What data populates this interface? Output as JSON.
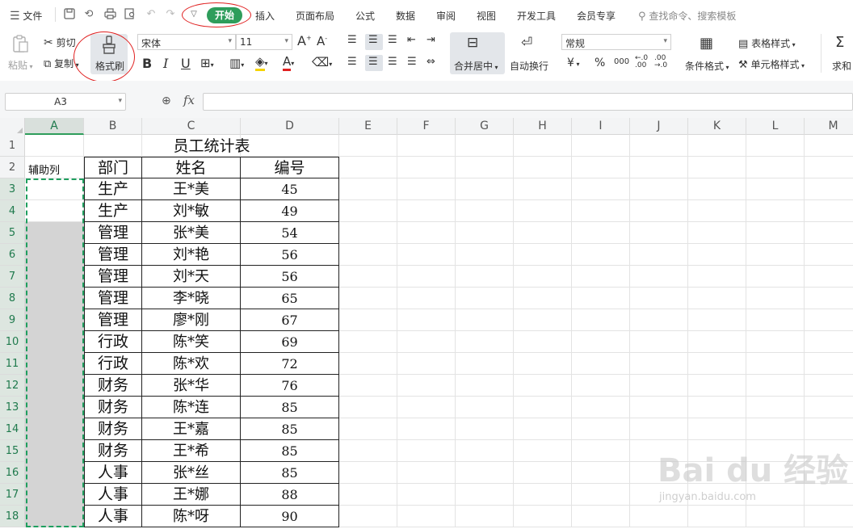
{
  "menubar": {
    "file_label": "文件",
    "tabs": [
      {
        "label": "开始",
        "active": true
      },
      {
        "label": "插入"
      },
      {
        "label": "页面布局"
      },
      {
        "label": "公式"
      },
      {
        "label": "数据"
      },
      {
        "label": "审阅"
      },
      {
        "label": "视图"
      },
      {
        "label": "开发工具"
      },
      {
        "label": "会员专享"
      }
    ],
    "search_placeholder": "查找命令、搜索模板"
  },
  "ribbon": {
    "paste": "粘贴",
    "cut": "剪切",
    "copy": "复制",
    "format_painter": "格式刷",
    "font_name": "宋体",
    "font_size": "11",
    "merge_center": "合并居中",
    "wrap_text": "自动换行",
    "number_format": "常规",
    "conditional_format": "条件格式",
    "table_style": "表格样式",
    "cell_style": "单元格样式",
    "sum": "求和",
    "currency_symbol": "¥",
    "percent_symbol": "%",
    "thousands_symbol": "000",
    "increase_decimal": "←.0\n.00",
    "decrease_decimal": ".00\n→.0"
  },
  "formula_bar": {
    "cell_ref": "A3",
    "fx": "fx",
    "formula": ""
  },
  "grid": {
    "columns": [
      "A",
      "B",
      "C",
      "D",
      "E",
      "F",
      "G",
      "H",
      "I",
      "J",
      "K",
      "L",
      "M"
    ],
    "rows": [
      "1",
      "2",
      "3",
      "4",
      "5",
      "6",
      "7",
      "8",
      "9",
      "10",
      "11",
      "12",
      "13",
      "14",
      "15",
      "16",
      "17",
      "18"
    ],
    "aux_label": "辅助列",
    "title": "员工统计表",
    "headers": [
      "部门",
      "姓名",
      "编号"
    ],
    "records": [
      [
        "生产",
        "王*美",
        "45"
      ],
      [
        "生产",
        "刘*敏",
        "49"
      ],
      [
        "管理",
        "张*美",
        "54"
      ],
      [
        "管理",
        "刘*艳",
        "56"
      ],
      [
        "管理",
        "刘*天",
        "56"
      ],
      [
        "管理",
        "李*晓",
        "65"
      ],
      [
        "管理",
        "廖*刚",
        "67"
      ],
      [
        "行政",
        "陈*笑",
        "69"
      ],
      [
        "行政",
        "陈*欢",
        "72"
      ],
      [
        "财务",
        "张*华",
        "76"
      ],
      [
        "财务",
        "陈*连",
        "85"
      ],
      [
        "财务",
        "王*嘉",
        "85"
      ],
      [
        "财务",
        "王*希",
        "85"
      ],
      [
        "人事",
        "张*丝",
        "85"
      ],
      [
        "人事",
        "王*娜",
        "88"
      ],
      [
        "人事",
        "陈*呀",
        "90"
      ]
    ]
  },
  "watermark": {
    "brand": "Bai du 经验",
    "url": "jingyan.baidu.com"
  }
}
